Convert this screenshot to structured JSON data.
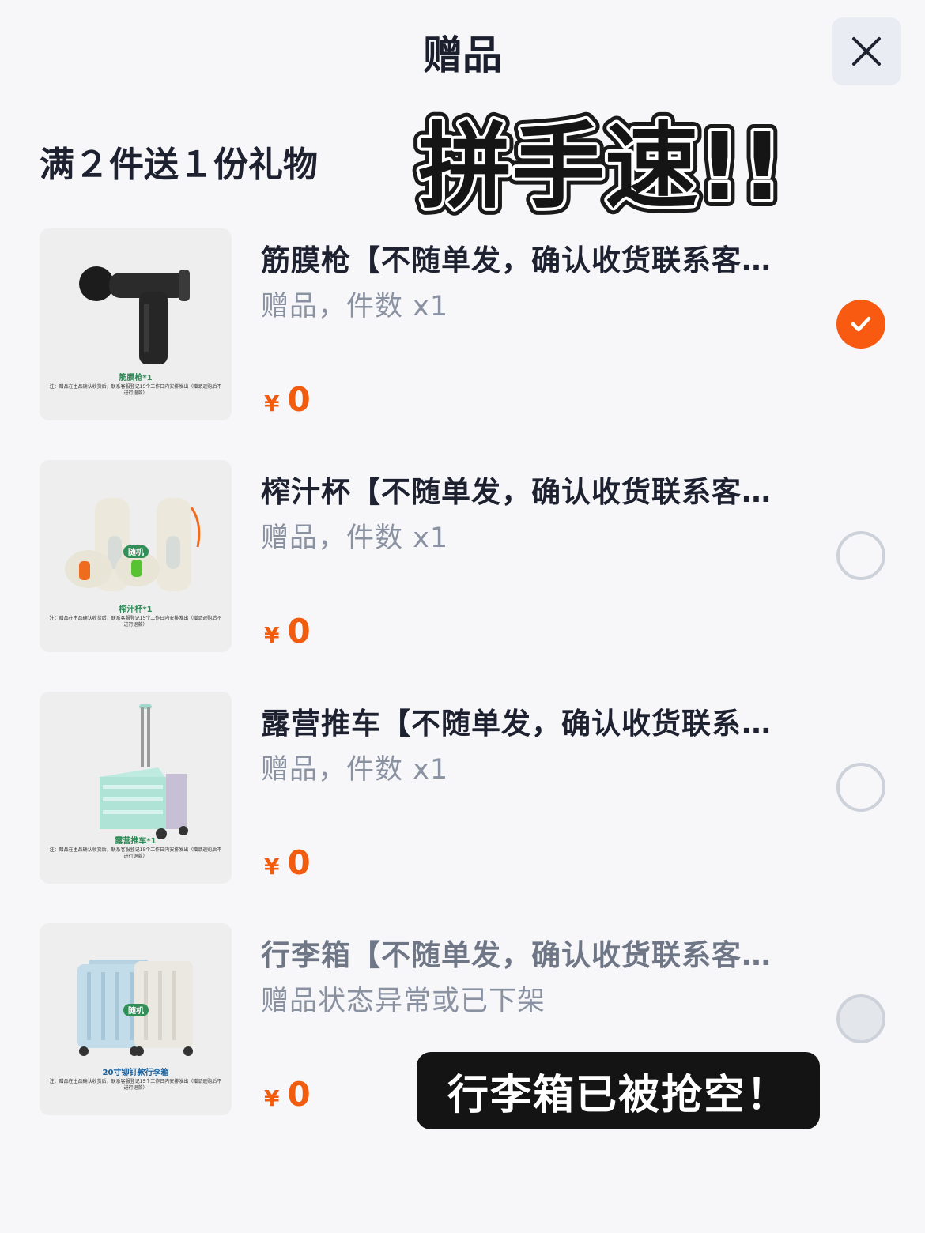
{
  "header": {
    "title": "赠品",
    "close_icon": "close-icon"
  },
  "promo": "满２件送１份礼物",
  "sticker_text": "拼手速!!",
  "gifts": [
    {
      "name": "筋膜枪【不随单发，确认收货联系客服登记】",
      "meta": "赠品，件数 x1",
      "currency": "¥",
      "price": "0",
      "selected": true,
      "available": true,
      "thumb_caption": "筋膜枪*1",
      "thumb_note": "注：赠品在主品确认收货后，联系客服登记15个工作日内安排发出（赠品退购后不进行退款）",
      "thumb_badge": ""
    },
    {
      "name": "榨汁杯【不随单发，确认收货联系客服登记】",
      "meta": "赠品，件数 x1",
      "currency": "¥",
      "price": "0",
      "selected": false,
      "available": true,
      "thumb_caption": "榨汁杯*1",
      "thumb_note": "注：赠品在主品确认收货后，联系客服登记15个工作日内安排发出（赠品退购后不进行退款）",
      "thumb_badge": "随机"
    },
    {
      "name": "露营推车【不随单发，确认收货联系客服登记】",
      "meta": "赠品，件数 x1",
      "currency": "¥",
      "price": "0",
      "selected": false,
      "available": true,
      "thumb_caption": "露营推车*1",
      "thumb_note": "注：赠品在主品确认收货后，联系客服登记15个工作日内安排发出（赠品退购后不进行退款）",
      "thumb_badge": ""
    },
    {
      "name": "行李箱【不随单发，确认收货联系客服登记】",
      "meta": "赠品状态异常或已下架",
      "currency": "¥",
      "price": "0",
      "selected": false,
      "available": false,
      "thumb_caption": "20寸铆钉款行李箱",
      "thumb_note": "注：赠品在主品确认收货后，联系客服登记15个工作日内安排发出（赠品退购后不进行退款）",
      "thumb_badge": "随机"
    }
  ],
  "toast": "行李箱已被抢空！",
  "colors": {
    "accent": "#f75a10",
    "price": "#f25c0e",
    "text": "#1d2130",
    "muted": "#8a92a2"
  }
}
